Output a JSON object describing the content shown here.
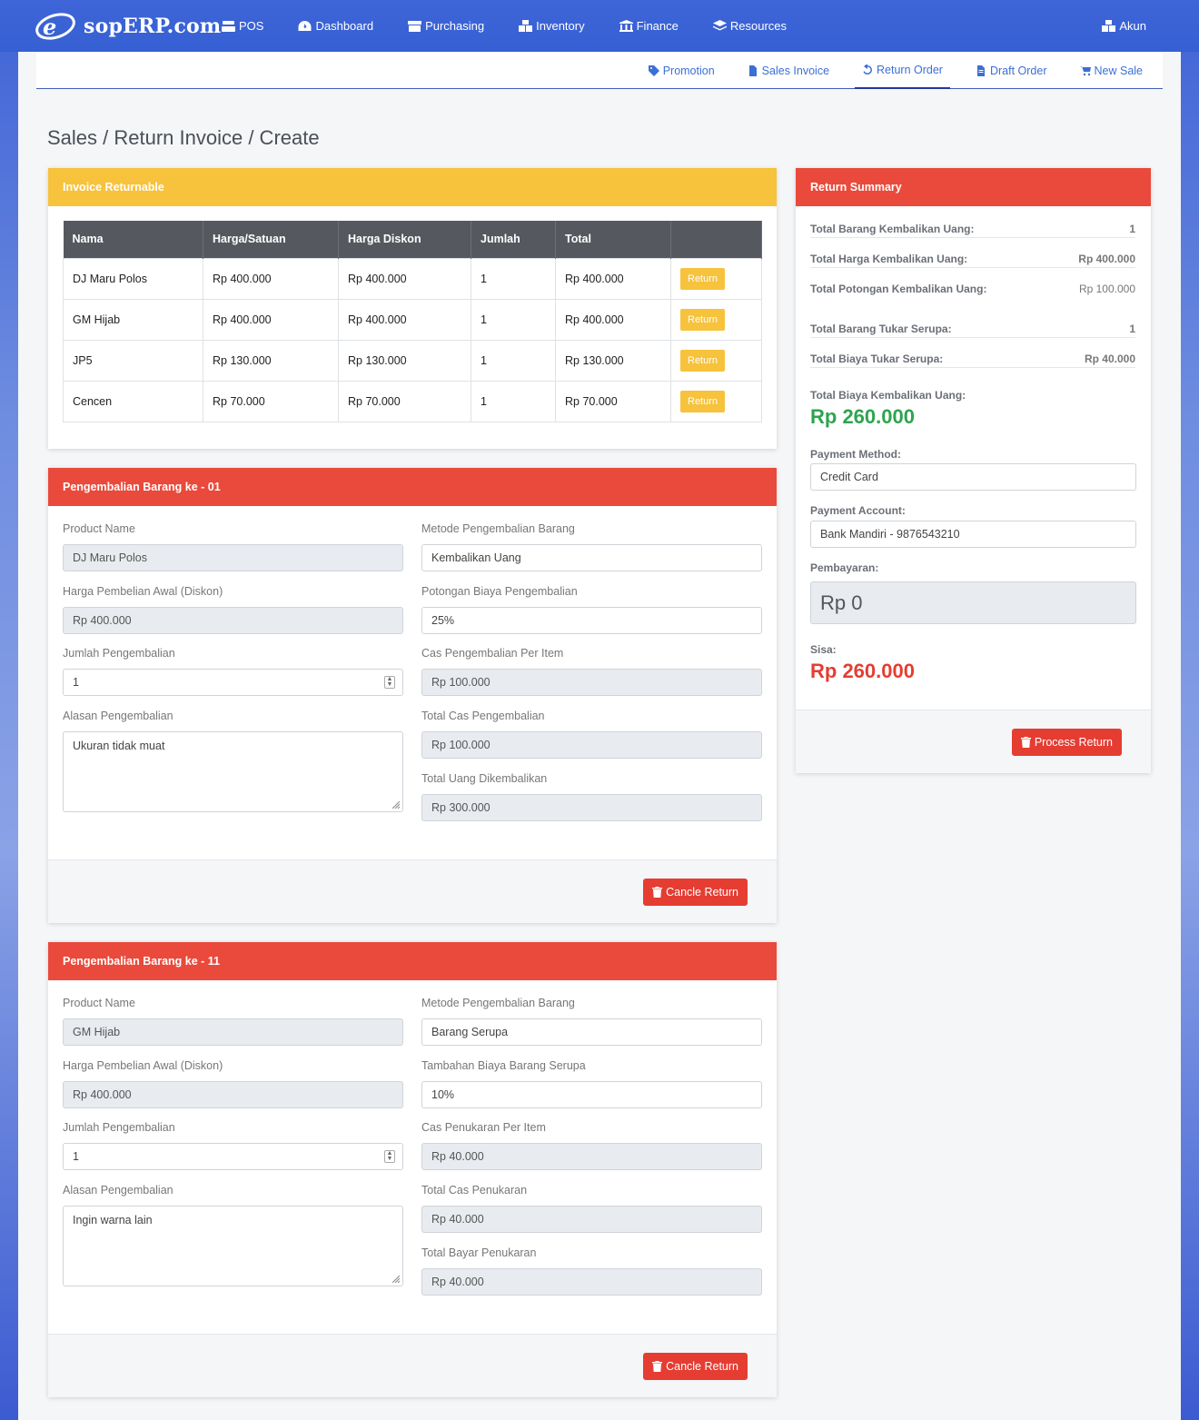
{
  "brand": {
    "name": "sopERP.com"
  },
  "nav": {
    "items": [
      {
        "label": "POS",
        "icon": "register-icon"
      },
      {
        "label": "Dashboard",
        "icon": "dashboard-icon"
      },
      {
        "label": "Purchasing",
        "icon": "box-icon"
      },
      {
        "label": "Inventory",
        "icon": "cubes-icon"
      },
      {
        "label": "Finance",
        "icon": "bank-icon"
      },
      {
        "label": "Resources",
        "icon": "layers-icon"
      }
    ],
    "account": "Akun"
  },
  "subnav": {
    "items": [
      {
        "label": "Promotion",
        "icon": "tag-icon"
      },
      {
        "label": "Sales Invoice",
        "icon": "file-icon"
      },
      {
        "label": "Return Order",
        "icon": "undo-icon",
        "active": true
      },
      {
        "label": "Draft Order",
        "icon": "draft-icon"
      },
      {
        "label": "New Sale",
        "icon": "cart-icon"
      }
    ]
  },
  "page": {
    "title": "Sales / Return Invoice / Create"
  },
  "invoice": {
    "header": "Invoice Returnable",
    "columns": [
      "Nama",
      "Harga/Satuan",
      "Harga Diskon",
      "Jumlah",
      "Total",
      ""
    ],
    "rows": [
      {
        "nama": "DJ Maru Polos",
        "harga": "Rp 400.000",
        "diskon": "Rp 400.000",
        "jumlah": "1",
        "total": "Rp 400.000"
      },
      {
        "nama": "GM Hijab",
        "harga": "Rp 400.000",
        "diskon": "Rp 400.000",
        "jumlah": "1",
        "total": "Rp 400.000"
      },
      {
        "nama": "JP5",
        "harga": "Rp 130.000",
        "diskon": "Rp 130.000",
        "jumlah": "1",
        "total": "Rp 130.000"
      },
      {
        "nama": "Cencen",
        "harga": "Rp 70.000",
        "diskon": "Rp 70.000",
        "jumlah": "1",
        "total": "Rp 70.000"
      }
    ],
    "return_label": "Return"
  },
  "returns": [
    {
      "header": "Pengembalian Barang ke - 01",
      "product_name_label": "Product Name",
      "product_name": "DJ Maru Polos",
      "harga_label": "Harga Pembelian Awal (Diskon)",
      "harga": "Rp 400.000",
      "jumlah_label": "Jumlah Pengembalian",
      "jumlah": "1",
      "alasan_label": "Alasan Pengembalian",
      "alasan": "Ukuran tidak muat",
      "metode_label": "Metode Pengembalian Barang",
      "metode": "Kembalikan Uang",
      "potongan_label": "Potongan Biaya Pengembalian",
      "potongan": "25%",
      "cas_item_label": "Cas Pengembalian Per Item",
      "cas_item": "Rp 100.000",
      "total_cas_label": "Total Cas Pengembalian",
      "total_cas": "Rp 100.000",
      "total_uang_label": "Total Uang Dikembalikan",
      "total_uang": "Rp 300.000",
      "cancel_label": "Cancle Return"
    },
    {
      "header": "Pengembalian Barang ke - 11",
      "product_name_label": "Product Name",
      "product_name": "GM Hijab",
      "harga_label": "Harga Pembelian Awal (Diskon)",
      "harga": "Rp 400.000",
      "jumlah_label": "Jumlah Pengembalian",
      "jumlah": "1",
      "alasan_label": "Alasan Pengembalian",
      "alasan": "Ingin warna lain",
      "metode_label": "Metode Pengembalian Barang",
      "metode": "Barang Serupa",
      "potongan_label": "Tambahan Biaya Barang Serupa",
      "potongan": "10%",
      "cas_item_label": "Cas Penukaran Per Item",
      "cas_item": "Rp 40.000",
      "total_cas_label": "Total Cas Penukaran",
      "total_cas": "Rp 40.000",
      "total_uang_label": "Total Bayar Penukaran",
      "total_uang": "Rp 40.000",
      "cancel_label": "Cancle Return"
    }
  ],
  "summary": {
    "header": "Return Summary",
    "rows": [
      {
        "label": "Total Barang Kembalikan Uang:",
        "value": "1"
      },
      {
        "label": "Total Harga Kembalikan Uang:",
        "value": "Rp 400.000"
      },
      {
        "label": "Total Potongan Kembalikan Uang:",
        "value": "Rp 100.000"
      },
      {
        "label": "Total Barang Tukar Serupa:",
        "value": "1"
      },
      {
        "label": "Total Biaya Tukar Serupa:",
        "value": "Rp 40.000"
      }
    ],
    "total_refund_label": "Total Biaya Kembalikan Uang:",
    "total_refund": "Rp 260.000",
    "payment_method_label": "Payment Method:",
    "payment_method": "Credit Card",
    "payment_account_label": "Payment Account:",
    "payment_account": "Bank Mandiri - 9876543210",
    "pembayaran_label": "Pembayaran:",
    "pembayaran": "Rp 0",
    "sisa_label": "Sisa:",
    "sisa": "Rp 260.000",
    "process_label": "Process Return"
  },
  "colors": {
    "primary": "#3560d3",
    "yellow": "#f7c23c",
    "red": "#e94a3b",
    "green": "#2ea44f"
  }
}
